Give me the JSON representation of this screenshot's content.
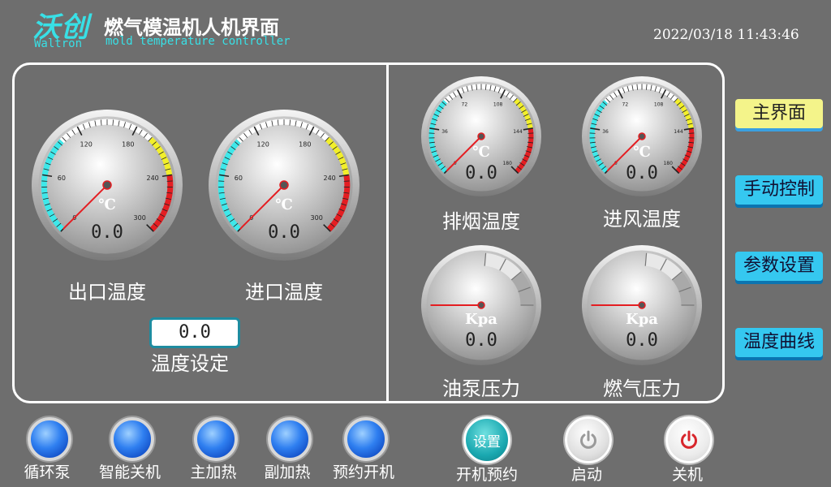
{
  "header": {
    "brand_cn": "沃创",
    "brand_en": "Waltron",
    "title": "燃气模温机人机界面",
    "subtitle": "mold temperature controller",
    "datetime": "2022/03/18  11:43:46"
  },
  "gauges_large": [
    {
      "label": "出口温度",
      "unit": "℃",
      "value": "0.0",
      "ticks": [
        "0",
        "60",
        "120",
        "180",
        "240",
        "300"
      ]
    },
    {
      "label": "进口温度",
      "unit": "℃",
      "value": "0.0",
      "ticks": [
        "0",
        "60",
        "120",
        "180",
        "240",
        "300"
      ]
    }
  ],
  "gauges_small_temp": [
    {
      "label": "排烟温度",
      "unit": "℃",
      "value": "0.0",
      "ticks": [
        "0",
        "36",
        "72",
        "108",
        "144",
        "180"
      ]
    },
    {
      "label": "进风温度",
      "unit": "℃",
      "value": "0.0",
      "ticks": [
        "0",
        "36",
        "72",
        "108",
        "144",
        "180"
      ]
    }
  ],
  "gauges_pressure": [
    {
      "label": "油泵压力",
      "unit": "Kpa",
      "value": "0.0"
    },
    {
      "label": "燃气压力",
      "unit": "Kpa",
      "value": "0.0"
    }
  ],
  "setpoint": {
    "value": "0.0",
    "label": "温度设定"
  },
  "nav": {
    "main": "主界面",
    "manual": "手动控制",
    "params": "参数设置",
    "curve": "温度曲线"
  },
  "indicators": [
    "循环泵",
    "智能关机",
    "主加热",
    "副加热",
    "预约开机"
  ],
  "schedule": {
    "button": "设置",
    "label": "开机预约"
  },
  "start": {
    "label": "启动"
  },
  "stop": {
    "label": "关机"
  },
  "colors": {
    "accent": "#38e0e6",
    "nav_blue": "#35c8f0",
    "nav_active": "#f4f48a",
    "stop_red": "#d8262c"
  }
}
